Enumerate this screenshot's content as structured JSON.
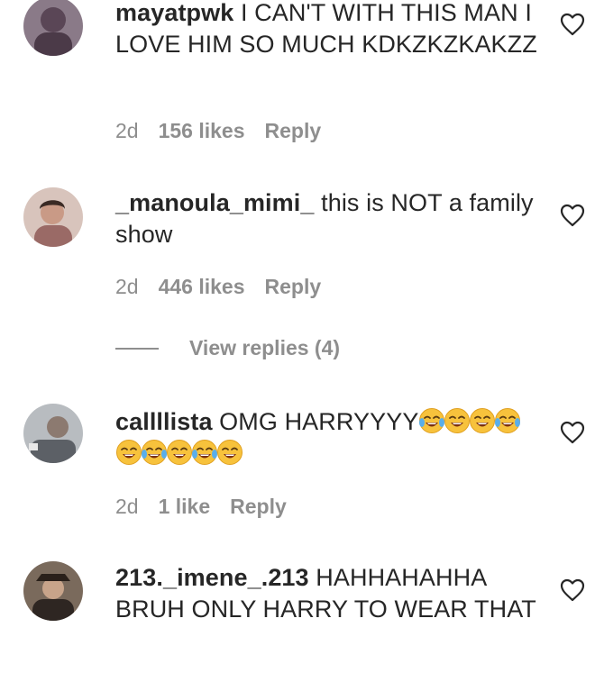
{
  "comments": [
    {
      "username": "mayatpwk",
      "text": " I CAN'T WITH THIS MAN I LOVE HIM SO MUCH KDKZKZKAKZZ",
      "age": "2d",
      "likes": "156 likes",
      "reply": "Reply",
      "avatar_color": "#6b5a6a"
    },
    {
      "username": "_manoula_mimi_",
      "text": " this is NOT a family show",
      "age": "2d",
      "likes": "446 likes",
      "reply": "Reply",
      "view_replies": "View replies (4)",
      "avatar_color": "#b08a80"
    },
    {
      "username": "callllista",
      "text": " OMG HARRYYYY",
      "emojis": [
        "face-with-tears-of-joy",
        "grinning-squinting-face",
        "grinning-squinting-face",
        "loudly-crying-face",
        "grinning-squinting-face",
        "loudly-crying-face",
        "grinning-squinting-face",
        "loudly-crying-face",
        "grinning-squinting-face"
      ],
      "age": "2d",
      "likes": "1 like",
      "reply": "Reply",
      "avatar_color": "#8a8f94"
    },
    {
      "username": "213._imene_.213",
      "text": " HAHHAHAHHA BRUH ONLY HARRY TO WEAR THAT",
      "avatar_color": "#4a3a30"
    }
  ],
  "colors": {
    "text": "#262626",
    "secondary": "#8e8e8e",
    "emoji_yellow": "#f7c23c"
  }
}
